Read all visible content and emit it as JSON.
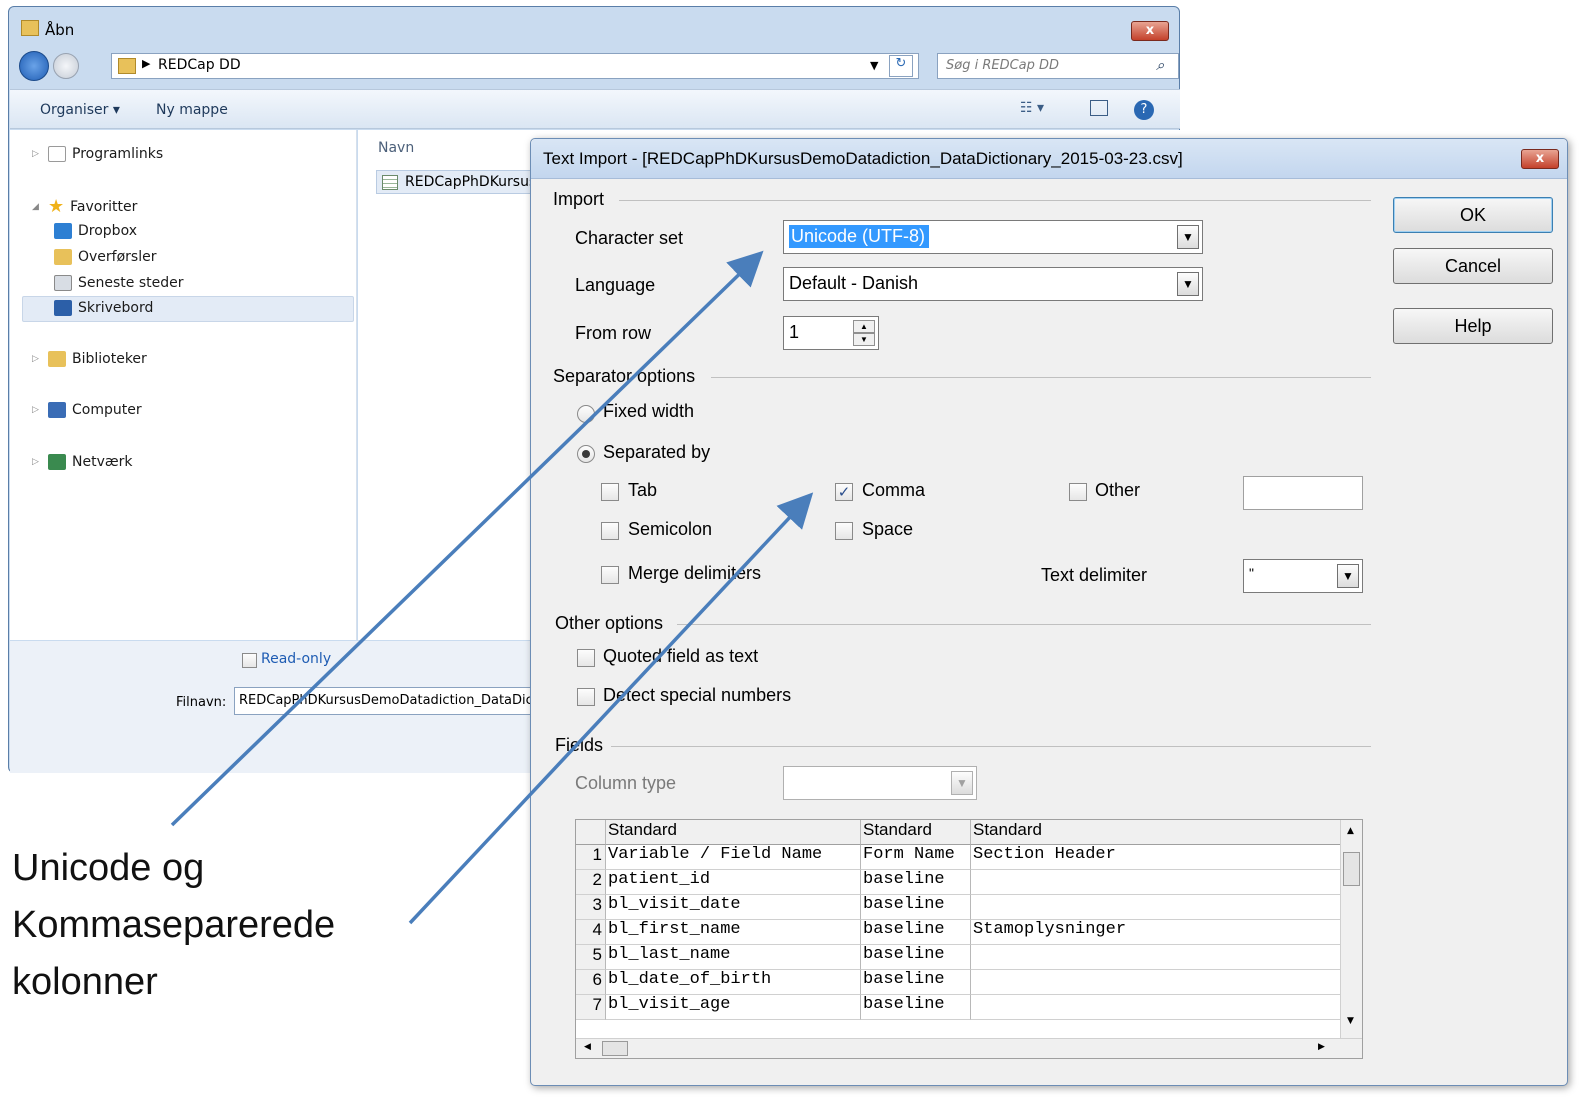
{
  "open_window": {
    "title": "Åbn",
    "address_path": "REDCap DD",
    "search_placeholder": "Søg i REDCap DD",
    "toolbar": {
      "organise_label": "Organiser ▾",
      "new_folder_label": "Ny mappe"
    },
    "nav": {
      "programlinks": "Programlinks",
      "favorites": "Favoritter",
      "dropbox": "Dropbox",
      "downloads": "Overførsler",
      "recent": "Seneste steder",
      "desktop": "Skrivebord",
      "libraries": "Biblioteker",
      "computer": "Computer",
      "network": "Netværk"
    },
    "column_name": "Navn",
    "file_name_short": "REDCapPhDKursusI",
    "readonly_label": "Read-only",
    "filename_label": "Filnavn:",
    "filename_value": "REDCapPhDKursusDemoDatadiction_DataDict"
  },
  "dialog": {
    "title": "Text Import - [REDCapPhDKursusDemoDatadiction_DataDictionary_2015-03-23.csv]",
    "close_label": "x",
    "import_section": "Import",
    "charset_label": "Character set",
    "charset_value": "Unicode (UTF-8)",
    "language_label": "Language",
    "language_value": "Default - Danish",
    "from_row_label": "From row",
    "from_row_value": "1",
    "separator_section": "Separator options",
    "fixed_width_label": "Fixed width",
    "separated_by_label": "Separated by",
    "tab_label": "Tab",
    "comma_label": "Comma",
    "other_label": "Other",
    "semicolon_label": "Semicolon",
    "space_label": "Space",
    "merge_label": "Merge delimiters",
    "text_delimiter_label": "Text delimiter",
    "text_delimiter_value": "\"",
    "other_section": "Other options",
    "quoted_label": "Quoted field as text",
    "detect_label": "Detect special numbers",
    "fields_section": "Fields",
    "column_type_label": "Column type",
    "ok_label": "OK",
    "cancel_label": "Cancel",
    "help_label": "Help",
    "preview": {
      "headers": [
        "Standard",
        "Standard",
        "Standard"
      ],
      "rows": [
        [
          "1",
          "Variable / Field Name",
          "Form Name",
          "Section Header"
        ],
        [
          "2",
          "patient_id",
          "baseline",
          ""
        ],
        [
          "3",
          "bl_visit_date",
          "baseline",
          ""
        ],
        [
          "4",
          "bl_first_name",
          "baseline",
          "Stamoplysninger"
        ],
        [
          "5",
          "bl_last_name",
          "baseline",
          ""
        ],
        [
          "6",
          "bl_date_of_birth",
          "baseline",
          ""
        ],
        [
          "7",
          "bl_visit_age",
          "baseline",
          ""
        ]
      ]
    }
  },
  "annotation": {
    "line1": "Unicode og",
    "line2": "Kommaseparerede",
    "line3": "kolonner",
    "arrow_color": "#4a7ebb"
  }
}
